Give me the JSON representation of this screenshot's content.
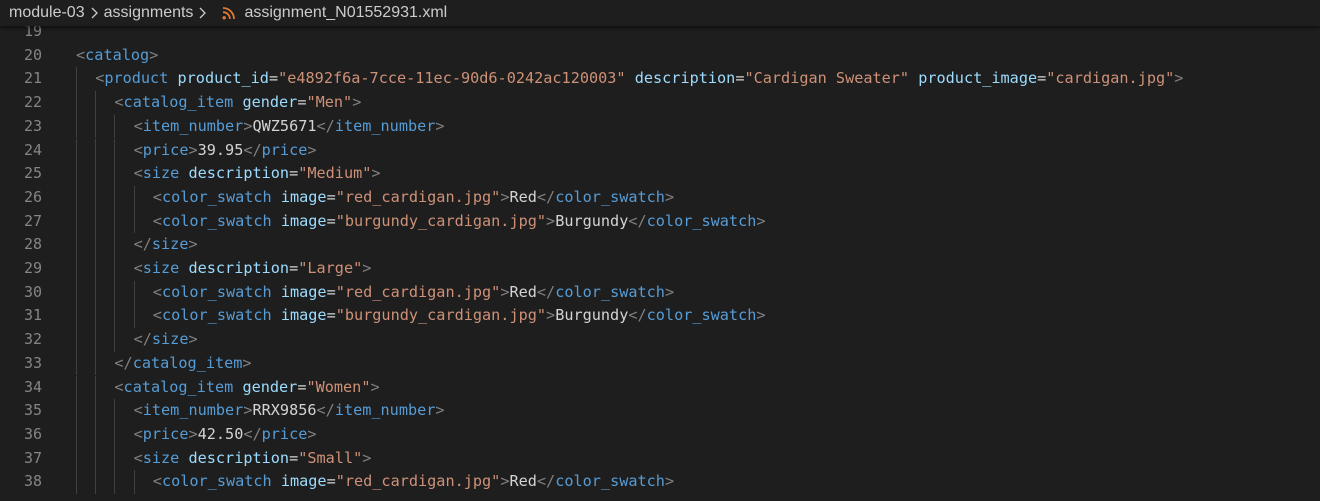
{
  "breadcrumb": {
    "items": [
      "module-03",
      "assignments",
      "assignment_N01552931.xml"
    ],
    "file_icon": "rss-feed-icon",
    "separator_icon": "chevron-right-icon"
  },
  "colors": {
    "background": "#1e1e1e",
    "line_number": "#858585",
    "punctuation": "#808080",
    "tag": "#569cd6",
    "attribute": "#9cdcfe",
    "string": "#ce9178",
    "text": "#d4d4d4",
    "rss_icon": "#e37933"
  },
  "editor": {
    "lines": [
      {
        "n": "19",
        "indent": 0,
        "tokens": []
      },
      {
        "n": "20",
        "indent": 0,
        "tokens": [
          {
            "t": "pun",
            "v": "<"
          },
          {
            "t": "tag",
            "v": "catalog"
          },
          {
            "t": "pun",
            "v": ">"
          }
        ]
      },
      {
        "n": "21",
        "indent": 1,
        "tokens": [
          {
            "t": "pun",
            "v": "<"
          },
          {
            "t": "tag",
            "v": "product"
          },
          {
            "t": "text",
            "v": " "
          },
          {
            "t": "attr",
            "v": "product_id"
          },
          {
            "t": "eq",
            "v": "="
          },
          {
            "t": "val",
            "v": "\"e4892f6a-7cce-11ec-90d6-0242ac120003\""
          },
          {
            "t": "text",
            "v": " "
          },
          {
            "t": "attr",
            "v": "description"
          },
          {
            "t": "eq",
            "v": "="
          },
          {
            "t": "val",
            "v": "\"Cardigan Sweater\""
          },
          {
            "t": "text",
            "v": " "
          },
          {
            "t": "attr",
            "v": "product_image"
          },
          {
            "t": "eq",
            "v": "="
          },
          {
            "t": "val",
            "v": "\"cardigan.jpg\""
          },
          {
            "t": "pun",
            "v": ">"
          }
        ]
      },
      {
        "n": "22",
        "indent": 2,
        "tokens": [
          {
            "t": "pun",
            "v": "<"
          },
          {
            "t": "tag",
            "v": "catalog_item"
          },
          {
            "t": "text",
            "v": " "
          },
          {
            "t": "attr",
            "v": "gender"
          },
          {
            "t": "eq",
            "v": "="
          },
          {
            "t": "val",
            "v": "\"Men\""
          },
          {
            "t": "pun",
            "v": ">"
          }
        ]
      },
      {
        "n": "23",
        "indent": 3,
        "tokens": [
          {
            "t": "pun",
            "v": "<"
          },
          {
            "t": "tag",
            "v": "item_number"
          },
          {
            "t": "pun",
            "v": ">"
          },
          {
            "t": "text",
            "v": "QWZ5671"
          },
          {
            "t": "pun",
            "v": "</"
          },
          {
            "t": "tag",
            "v": "item_number"
          },
          {
            "t": "pun",
            "v": ">"
          }
        ]
      },
      {
        "n": "24",
        "indent": 3,
        "tokens": [
          {
            "t": "pun",
            "v": "<"
          },
          {
            "t": "tag",
            "v": "price"
          },
          {
            "t": "pun",
            "v": ">"
          },
          {
            "t": "text",
            "v": "39.95"
          },
          {
            "t": "pun",
            "v": "</"
          },
          {
            "t": "tag",
            "v": "price"
          },
          {
            "t": "pun",
            "v": ">"
          }
        ]
      },
      {
        "n": "25",
        "indent": 3,
        "tokens": [
          {
            "t": "pun",
            "v": "<"
          },
          {
            "t": "tag",
            "v": "size"
          },
          {
            "t": "text",
            "v": " "
          },
          {
            "t": "attr",
            "v": "description"
          },
          {
            "t": "eq",
            "v": "="
          },
          {
            "t": "val",
            "v": "\"Medium\""
          },
          {
            "t": "pun",
            "v": ">"
          }
        ]
      },
      {
        "n": "26",
        "indent": 4,
        "tokens": [
          {
            "t": "pun",
            "v": "<"
          },
          {
            "t": "tag",
            "v": "color_swatch"
          },
          {
            "t": "text",
            "v": " "
          },
          {
            "t": "attr",
            "v": "image"
          },
          {
            "t": "eq",
            "v": "="
          },
          {
            "t": "val",
            "v": "\"red_cardigan.jpg\""
          },
          {
            "t": "pun",
            "v": ">"
          },
          {
            "t": "text",
            "v": "Red"
          },
          {
            "t": "pun",
            "v": "</"
          },
          {
            "t": "tag",
            "v": "color_swatch"
          },
          {
            "t": "pun",
            "v": ">"
          }
        ]
      },
      {
        "n": "27",
        "indent": 4,
        "tokens": [
          {
            "t": "pun",
            "v": "<"
          },
          {
            "t": "tag",
            "v": "color_swatch"
          },
          {
            "t": "text",
            "v": " "
          },
          {
            "t": "attr",
            "v": "image"
          },
          {
            "t": "eq",
            "v": "="
          },
          {
            "t": "val",
            "v": "\"burgundy_cardigan.jpg\""
          },
          {
            "t": "pun",
            "v": ">"
          },
          {
            "t": "text",
            "v": "Burgundy"
          },
          {
            "t": "pun",
            "v": "</"
          },
          {
            "t": "tag",
            "v": "color_swatch"
          },
          {
            "t": "pun",
            "v": ">"
          }
        ]
      },
      {
        "n": "28",
        "indent": 3,
        "tokens": [
          {
            "t": "pun",
            "v": "</"
          },
          {
            "t": "tag",
            "v": "size"
          },
          {
            "t": "pun",
            "v": ">"
          }
        ]
      },
      {
        "n": "29",
        "indent": 3,
        "tokens": [
          {
            "t": "pun",
            "v": "<"
          },
          {
            "t": "tag",
            "v": "size"
          },
          {
            "t": "text",
            "v": " "
          },
          {
            "t": "attr",
            "v": "description"
          },
          {
            "t": "eq",
            "v": "="
          },
          {
            "t": "val",
            "v": "\"Large\""
          },
          {
            "t": "pun",
            "v": ">"
          }
        ]
      },
      {
        "n": "30",
        "indent": 4,
        "tokens": [
          {
            "t": "pun",
            "v": "<"
          },
          {
            "t": "tag",
            "v": "color_swatch"
          },
          {
            "t": "text",
            "v": " "
          },
          {
            "t": "attr",
            "v": "image"
          },
          {
            "t": "eq",
            "v": "="
          },
          {
            "t": "val",
            "v": "\"red_cardigan.jpg\""
          },
          {
            "t": "pun",
            "v": ">"
          },
          {
            "t": "text",
            "v": "Red"
          },
          {
            "t": "pun",
            "v": "</"
          },
          {
            "t": "tag",
            "v": "color_swatch"
          },
          {
            "t": "pun",
            "v": ">"
          }
        ]
      },
      {
        "n": "31",
        "indent": 4,
        "tokens": [
          {
            "t": "pun",
            "v": "<"
          },
          {
            "t": "tag",
            "v": "color_swatch"
          },
          {
            "t": "text",
            "v": " "
          },
          {
            "t": "attr",
            "v": "image"
          },
          {
            "t": "eq",
            "v": "="
          },
          {
            "t": "val",
            "v": "\"burgundy_cardigan.jpg\""
          },
          {
            "t": "pun",
            "v": ">"
          },
          {
            "t": "text",
            "v": "Burgundy"
          },
          {
            "t": "pun",
            "v": "</"
          },
          {
            "t": "tag",
            "v": "color_swatch"
          },
          {
            "t": "pun",
            "v": ">"
          }
        ]
      },
      {
        "n": "32",
        "indent": 3,
        "tokens": [
          {
            "t": "pun",
            "v": "</"
          },
          {
            "t": "tag",
            "v": "size"
          },
          {
            "t": "pun",
            "v": ">"
          }
        ]
      },
      {
        "n": "33",
        "indent": 2,
        "tokens": [
          {
            "t": "pun",
            "v": "</"
          },
          {
            "t": "tag",
            "v": "catalog_item"
          },
          {
            "t": "pun",
            "v": ">"
          }
        ]
      },
      {
        "n": "34",
        "indent": 2,
        "tokens": [
          {
            "t": "pun",
            "v": "<"
          },
          {
            "t": "tag",
            "v": "catalog_item"
          },
          {
            "t": "text",
            "v": " "
          },
          {
            "t": "attr",
            "v": "gender"
          },
          {
            "t": "eq",
            "v": "="
          },
          {
            "t": "val",
            "v": "\"Women\""
          },
          {
            "t": "pun",
            "v": ">"
          }
        ]
      },
      {
        "n": "35",
        "indent": 3,
        "tokens": [
          {
            "t": "pun",
            "v": "<"
          },
          {
            "t": "tag",
            "v": "item_number"
          },
          {
            "t": "pun",
            "v": ">"
          },
          {
            "t": "text",
            "v": "RRX9856"
          },
          {
            "t": "pun",
            "v": "</"
          },
          {
            "t": "tag",
            "v": "item_number"
          },
          {
            "t": "pun",
            "v": ">"
          }
        ]
      },
      {
        "n": "36",
        "indent": 3,
        "tokens": [
          {
            "t": "pun",
            "v": "<"
          },
          {
            "t": "tag",
            "v": "price"
          },
          {
            "t": "pun",
            "v": ">"
          },
          {
            "t": "text",
            "v": "42.50"
          },
          {
            "t": "pun",
            "v": "</"
          },
          {
            "t": "tag",
            "v": "price"
          },
          {
            "t": "pun",
            "v": ">"
          }
        ]
      },
      {
        "n": "37",
        "indent": 3,
        "tokens": [
          {
            "t": "pun",
            "v": "<"
          },
          {
            "t": "tag",
            "v": "size"
          },
          {
            "t": "text",
            "v": " "
          },
          {
            "t": "attr",
            "v": "description"
          },
          {
            "t": "eq",
            "v": "="
          },
          {
            "t": "val",
            "v": "\"Small\""
          },
          {
            "t": "pun",
            "v": ">"
          }
        ]
      },
      {
        "n": "38",
        "indent": 4,
        "tokens": [
          {
            "t": "pun",
            "v": "<"
          },
          {
            "t": "tag",
            "v": "color_swatch"
          },
          {
            "t": "text",
            "v": " "
          },
          {
            "t": "attr",
            "v": "image"
          },
          {
            "t": "eq",
            "v": "="
          },
          {
            "t": "val",
            "v": "\"red_cardigan.jpg\""
          },
          {
            "t": "pun",
            "v": ">"
          },
          {
            "t": "text",
            "v": "Red"
          },
          {
            "t": "pun",
            "v": "</"
          },
          {
            "t": "tag",
            "v": "color_swatch"
          },
          {
            "t": "pun",
            "v": ">"
          }
        ]
      }
    ]
  }
}
